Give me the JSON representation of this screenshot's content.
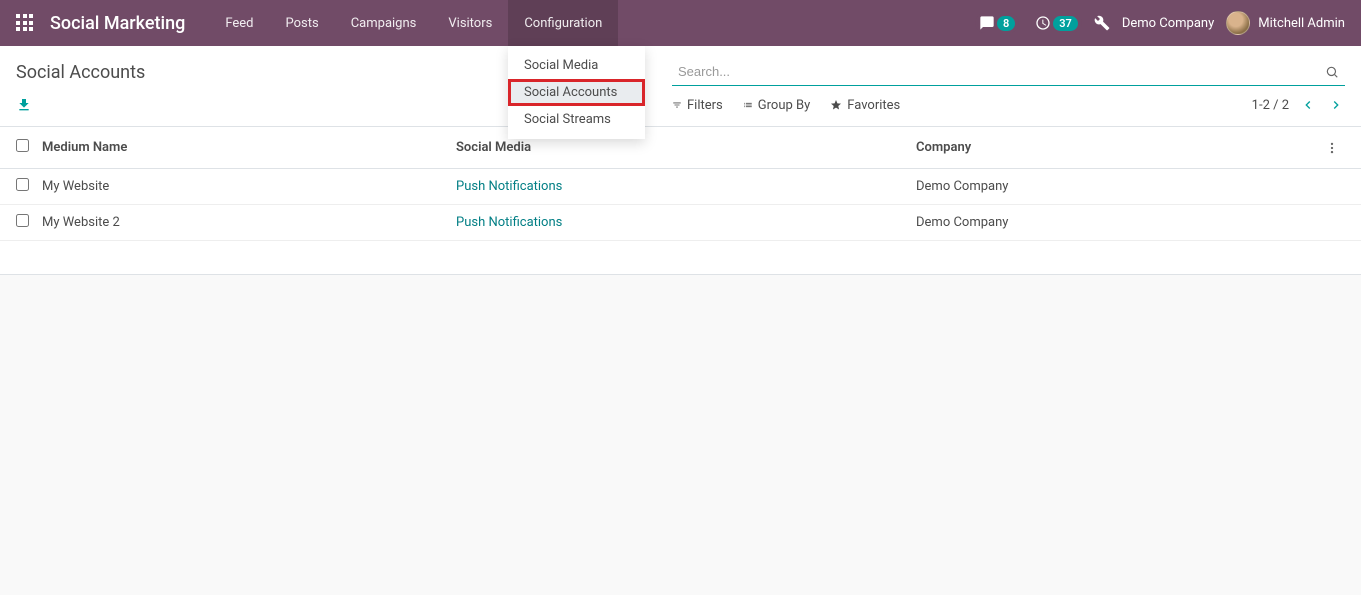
{
  "topbar": {
    "app_title": "Social Marketing",
    "nav": [
      "Feed",
      "Posts",
      "Campaigns",
      "Visitors",
      "Configuration"
    ],
    "active_nav": 4,
    "chat_count": "8",
    "activity_count": "37",
    "company": "Demo Company",
    "user": "Mitchell Admin"
  },
  "dropdown": {
    "items": [
      "Social Media",
      "Social Accounts",
      "Social Streams"
    ],
    "highlighted": 1
  },
  "control": {
    "breadcrumb": "Social Accounts",
    "search_placeholder": "Search...",
    "filters_label": "Filters",
    "groupby_label": "Group By",
    "favorites_label": "Favorites",
    "pager": "1-2 / 2"
  },
  "table": {
    "headers": {
      "name": "Medium Name",
      "media": "Social Media",
      "company": "Company"
    },
    "rows": [
      {
        "name": "My Website",
        "media": "Push Notifications",
        "company": "Demo Company"
      },
      {
        "name": "My Website 2",
        "media": "Push Notifications",
        "company": "Demo Company"
      }
    ]
  }
}
